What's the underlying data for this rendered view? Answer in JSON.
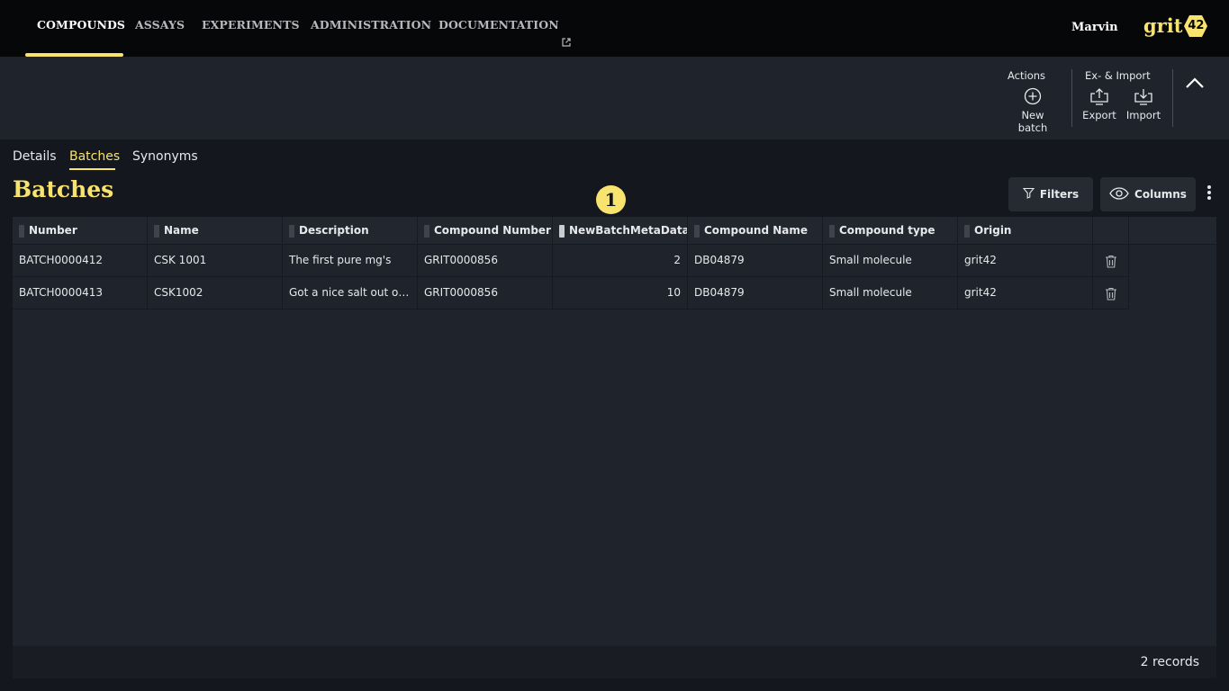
{
  "nav": {
    "items": [
      {
        "label": "COMPOUNDS",
        "active": true
      },
      {
        "label": "ASSAYS"
      },
      {
        "label": "EXPERIMENTS"
      },
      {
        "label": "ADMINISTRATION"
      },
      {
        "label": "DOCUMENTATION",
        "external": true
      }
    ],
    "user": "Marvin",
    "logo_text": "grit",
    "logo_badge": "42"
  },
  "toolbar": {
    "actions_label": "Actions",
    "new_batch_label": "New batch",
    "eximport_label": "Ex- & Import",
    "export_label": "Export",
    "import_label": "Import"
  },
  "subtabs": [
    {
      "label": "Details"
    },
    {
      "label": "Batches",
      "active": true
    },
    {
      "label": "Synonyms"
    }
  ],
  "page_title": "Batches",
  "step_badge": "1",
  "buttons": {
    "filters": "Filters",
    "columns": "Columns"
  },
  "grid": {
    "columns": [
      "Number",
      "Name",
      "Description",
      "Compound Number",
      "NewBatchMetaData",
      "Compound Name",
      "Compound type",
      "Origin"
    ],
    "rows": [
      [
        "BATCH0000412",
        "CSK 1001",
        "The first pure mg's",
        "GRIT0000856",
        "2",
        "DB04879",
        "Small molecule",
        "grit42"
      ],
      [
        "BATCH0000413",
        "CSK1002",
        "Got a nice salt out of the mix",
        "GRIT0000856",
        "10",
        "DB04879",
        "Small molecule",
        "grit42"
      ]
    ],
    "records": "2 records"
  },
  "colors": {
    "accent": "#f7e36e",
    "background": "#14171d",
    "panel": "#1f242c",
    "nav": "#060709"
  }
}
